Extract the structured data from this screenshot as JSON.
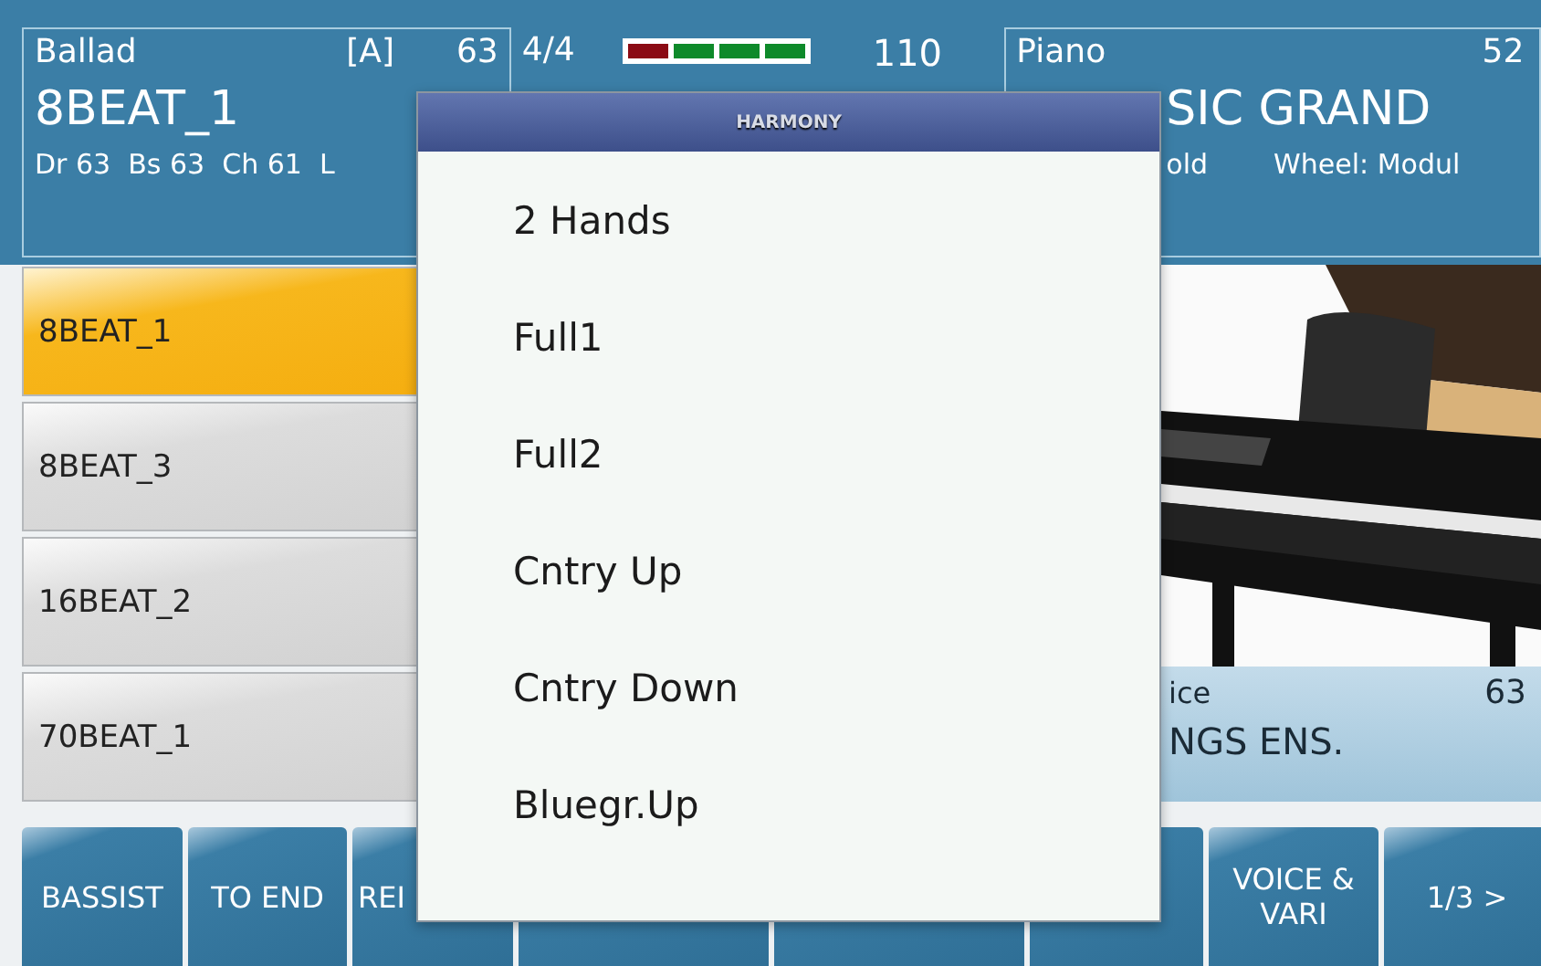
{
  "style_panel": {
    "genre": "Ballad",
    "variation": "[A]",
    "number": "63",
    "name": "8BEAT_1",
    "details": "Dr 63  Bs 63  Ch 61  L"
  },
  "tempo": {
    "time_signature": "4/4",
    "meter": [
      {
        "color": "#8b0a14"
      },
      {
        "color": "#0e8a2a"
      },
      {
        "color": "#0e8a2a"
      },
      {
        "color": "#0e8a2a"
      }
    ],
    "bpm": "110"
  },
  "voice_panel": {
    "category": "Piano",
    "number": "52",
    "name": "SIC GRAND",
    "hold": "old",
    "wheel": "Wheel: Modul"
  },
  "styles": [
    {
      "label": "8BEAT_1",
      "selected": true
    },
    {
      "label": "8BEAT_3",
      "selected": false
    },
    {
      "label": "16BEAT_2",
      "selected": false
    },
    {
      "label": "70BEAT_1",
      "selected": false
    }
  ],
  "lower_voice": {
    "label": "ice",
    "number": "63",
    "name": "NGS ENS."
  },
  "buttons": [
    {
      "kind": "labeled",
      "label": "BASSIST"
    },
    {
      "kind": "labeled",
      "label": "TO END"
    },
    {
      "kind": "labeled",
      "label": "REI"
    },
    {
      "kind": "covered"
    },
    {
      "kind": "covered"
    },
    {
      "kind": "covered"
    },
    {
      "kind": "labeled",
      "label": "VOICE & VARI"
    },
    {
      "kind": "labeled",
      "label": "1/3 >"
    }
  ],
  "harmony_menu": {
    "title": "HARMONY",
    "items": [
      "2 Hands",
      "Full1",
      "Full2",
      "Cntry Up",
      "Cntry Down",
      "Bluegr.Up"
    ]
  }
}
